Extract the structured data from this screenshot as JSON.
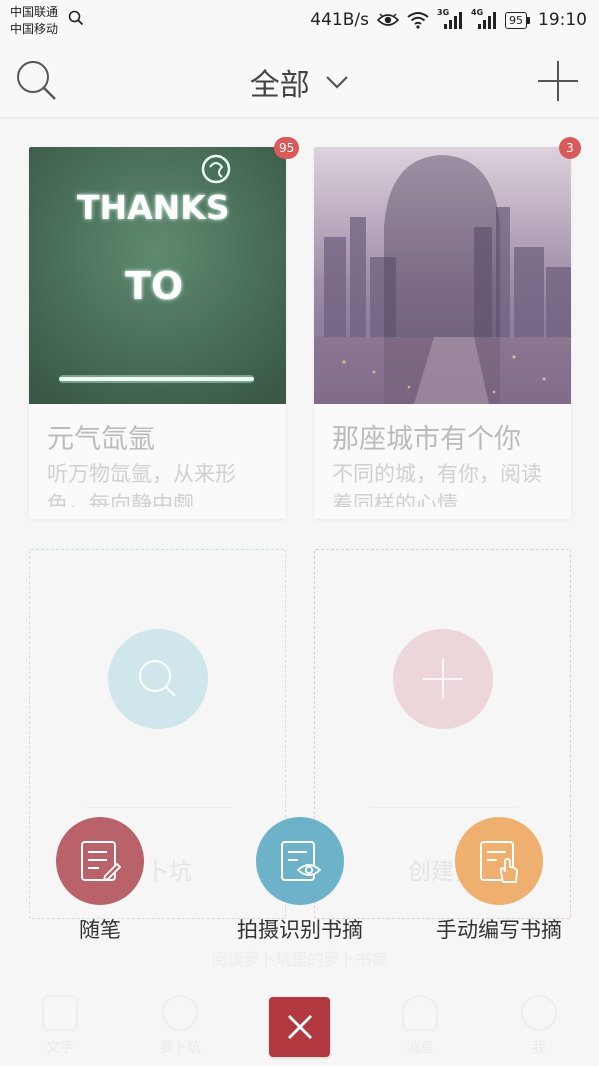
{
  "status_bar": {
    "carrier_1": "中国联通",
    "carrier_2": "中国移动",
    "net_speed": "441B/s",
    "signal_1_tag": "3G",
    "signal_2_tag": "4G",
    "battery": "95",
    "time": "19:10"
  },
  "header": {
    "title": "全部",
    "icons": [
      "search-icon",
      "chevron-down-icon",
      "plus-icon"
    ]
  },
  "cards": [
    {
      "title": "元气氙氩",
      "description": "听万物氙氩，从来形色，每向静中觑",
      "badge": "95",
      "cover_text_1": "THANKS",
      "cover_text_2": "TO"
    },
    {
      "title": "那座城市有个你",
      "description": "不同的城，有你，阅读着同样的心情",
      "badge": "3"
    }
  ],
  "placeholders": [
    {
      "label": "萝卜坑",
      "icon": "search-icon"
    },
    {
      "label": "创建萝",
      "icon": "plus-icon"
    }
  ],
  "hint_text": "阅读萝卜坑里的萝卜书摘",
  "tabs": [
    {
      "label": "文字"
    },
    {
      "label": "萝卜坑"
    },
    {
      "label": ""
    },
    {
      "label": "消息"
    },
    {
      "label": "我"
    }
  ],
  "actions": [
    {
      "label": "随笔",
      "color": "#b9626a",
      "icon": "note-edit-icon"
    },
    {
      "label": "拍摄识别书摘",
      "color": "#6eb2c9",
      "icon": "scan-eye-icon"
    },
    {
      "label": "手动编写书摘",
      "color": "#efb06f",
      "icon": "hand-write-icon"
    }
  ],
  "close_button": {
    "color": "#b2383f",
    "icon": "close-icon"
  }
}
